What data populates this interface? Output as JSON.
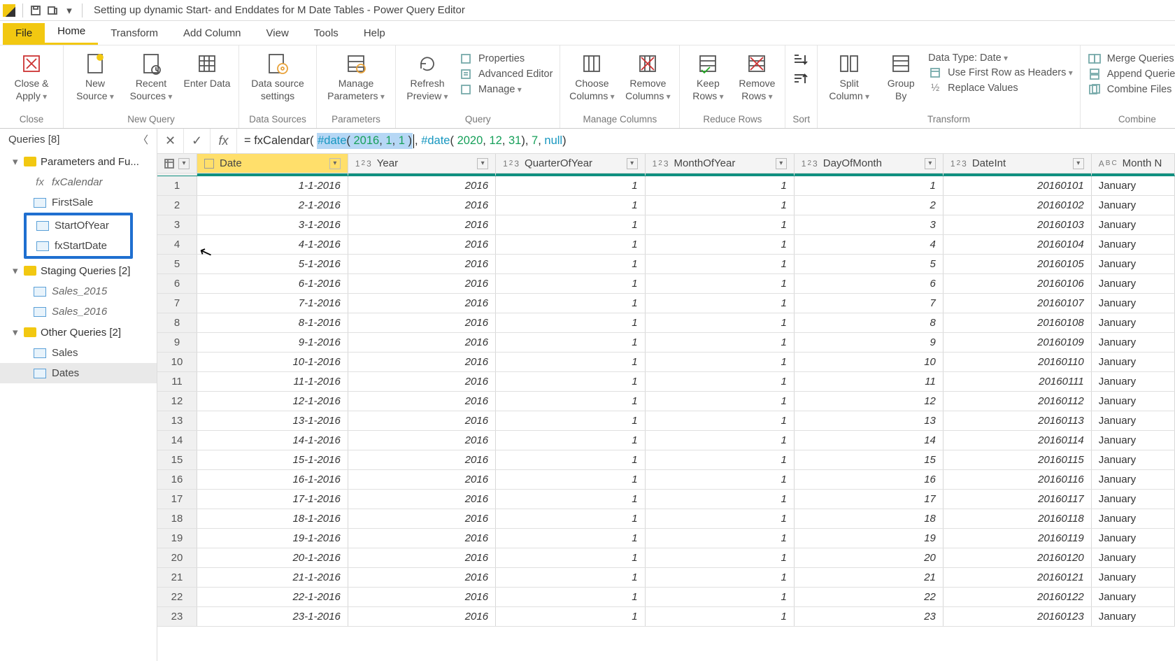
{
  "window": {
    "title": "Setting up dynamic Start- and Enddates for M Date Tables - Power Query Editor"
  },
  "tabs": {
    "file": "File",
    "home": "Home",
    "transform": "Transform",
    "addcolumn": "Add Column",
    "view": "View",
    "tools": "Tools",
    "help": "Help"
  },
  "ribbon": {
    "close_grp": "Close",
    "close_apply": "Close &\nApply",
    "newquery_grp": "New Query",
    "new_source": "New\nSource",
    "recent_sources": "Recent\nSources",
    "enter_data": "Enter\nData",
    "datasources_grp": "Data Sources",
    "data_source_settings": "Data source\nsettings",
    "parameters_grp": "Parameters",
    "manage_parameters": "Manage\nParameters",
    "query_grp": "Query",
    "refresh_preview": "Refresh\nPreview",
    "properties": "Properties",
    "advanced_editor": "Advanced Editor",
    "manage": "Manage",
    "managecols_grp": "Manage Columns",
    "choose_columns": "Choose\nColumns",
    "remove_columns": "Remove\nColumns",
    "reducerows_grp": "Reduce Rows",
    "keep_rows": "Keep\nRows",
    "remove_rows": "Remove\nRows",
    "sort_grp": "Sort",
    "transform_grp": "Transform",
    "split_column": "Split\nColumn",
    "group_by": "Group\nBy",
    "data_type": "Data Type: Date",
    "first_row_headers": "Use First Row as Headers",
    "replace_values": "Replace Values",
    "combine_grp": "Combine",
    "merge_queries": "Merge Queries",
    "append_queries": "Append Queries",
    "combine_files": "Combine Files"
  },
  "side": {
    "header": "Queries [8]",
    "group_params": "Parameters and Fu...",
    "fxCalendar": "fxCalendar",
    "firstSale": "FirstSale",
    "startOfYear": "StartOfYear",
    "fxStartDate": "fxStartDate",
    "group_staging": "Staging Queries [2]",
    "sales_2015": "Sales_2015",
    "sales_2016": "Sales_2016",
    "group_other": "Other Queries [2]",
    "sales": "Sales",
    "dates": "Dates"
  },
  "formula": {
    "pre": "= fxCalendar( ",
    "sel_open": "#date",
    "sel_paren": "( ",
    "sel_n1": "2016",
    "sel_c1": ", ",
    "sel_n2": "1",
    "sel_c2": ", ",
    "sel_n3": "1",
    "sel_close": " )",
    "mid": ", ",
    "kw2": "#date",
    "p2": "( ",
    "n4": "2020",
    "c3": ", ",
    "n5": "12",
    "c4": ", ",
    "n6": "31",
    "p2c": "), ",
    "n7": "7",
    "c5": ", ",
    "null": "null",
    "end": ")"
  },
  "columns": {
    "date": "Date",
    "year": "Year",
    "quarter": "QuarterOfYear",
    "month": "MonthOfYear",
    "day": "DayOfMonth",
    "dateint": "DateInt",
    "monthname": "Month N"
  },
  "rows": [
    {
      "n": 1,
      "date": "1-1-2016",
      "year": 2016,
      "q": 1,
      "m": 1,
      "d": 1,
      "di": 20160101,
      "mn": "January"
    },
    {
      "n": 2,
      "date": "2-1-2016",
      "year": 2016,
      "q": 1,
      "m": 1,
      "d": 2,
      "di": 20160102,
      "mn": "January"
    },
    {
      "n": 3,
      "date": "3-1-2016",
      "year": 2016,
      "q": 1,
      "m": 1,
      "d": 3,
      "di": 20160103,
      "mn": "January"
    },
    {
      "n": 4,
      "date": "4-1-2016",
      "year": 2016,
      "q": 1,
      "m": 1,
      "d": 4,
      "di": 20160104,
      "mn": "January"
    },
    {
      "n": 5,
      "date": "5-1-2016",
      "year": 2016,
      "q": 1,
      "m": 1,
      "d": 5,
      "di": 20160105,
      "mn": "January"
    },
    {
      "n": 6,
      "date": "6-1-2016",
      "year": 2016,
      "q": 1,
      "m": 1,
      "d": 6,
      "di": 20160106,
      "mn": "January"
    },
    {
      "n": 7,
      "date": "7-1-2016",
      "year": 2016,
      "q": 1,
      "m": 1,
      "d": 7,
      "di": 20160107,
      "mn": "January"
    },
    {
      "n": 8,
      "date": "8-1-2016",
      "year": 2016,
      "q": 1,
      "m": 1,
      "d": 8,
      "di": 20160108,
      "mn": "January"
    },
    {
      "n": 9,
      "date": "9-1-2016",
      "year": 2016,
      "q": 1,
      "m": 1,
      "d": 9,
      "di": 20160109,
      "mn": "January"
    },
    {
      "n": 10,
      "date": "10-1-2016",
      "year": 2016,
      "q": 1,
      "m": 1,
      "d": 10,
      "di": 20160110,
      "mn": "January"
    },
    {
      "n": 11,
      "date": "11-1-2016",
      "year": 2016,
      "q": 1,
      "m": 1,
      "d": 11,
      "di": 20160111,
      "mn": "January"
    },
    {
      "n": 12,
      "date": "12-1-2016",
      "year": 2016,
      "q": 1,
      "m": 1,
      "d": 12,
      "di": 20160112,
      "mn": "January"
    },
    {
      "n": 13,
      "date": "13-1-2016",
      "year": 2016,
      "q": 1,
      "m": 1,
      "d": 13,
      "di": 20160113,
      "mn": "January"
    },
    {
      "n": 14,
      "date": "14-1-2016",
      "year": 2016,
      "q": 1,
      "m": 1,
      "d": 14,
      "di": 20160114,
      "mn": "January"
    },
    {
      "n": 15,
      "date": "15-1-2016",
      "year": 2016,
      "q": 1,
      "m": 1,
      "d": 15,
      "di": 20160115,
      "mn": "January"
    },
    {
      "n": 16,
      "date": "16-1-2016",
      "year": 2016,
      "q": 1,
      "m": 1,
      "d": 16,
      "di": 20160116,
      "mn": "January"
    },
    {
      "n": 17,
      "date": "17-1-2016",
      "year": 2016,
      "q": 1,
      "m": 1,
      "d": 17,
      "di": 20160117,
      "mn": "January"
    },
    {
      "n": 18,
      "date": "18-1-2016",
      "year": 2016,
      "q": 1,
      "m": 1,
      "d": 18,
      "di": 20160118,
      "mn": "January"
    },
    {
      "n": 19,
      "date": "19-1-2016",
      "year": 2016,
      "q": 1,
      "m": 1,
      "d": 19,
      "di": 20160119,
      "mn": "January"
    },
    {
      "n": 20,
      "date": "20-1-2016",
      "year": 2016,
      "q": 1,
      "m": 1,
      "d": 20,
      "di": 20160120,
      "mn": "January"
    },
    {
      "n": 21,
      "date": "21-1-2016",
      "year": 2016,
      "q": 1,
      "m": 1,
      "d": 21,
      "di": 20160121,
      "mn": "January"
    },
    {
      "n": 22,
      "date": "22-1-2016",
      "year": 2016,
      "q": 1,
      "m": 1,
      "d": 22,
      "di": 20160122,
      "mn": "January"
    },
    {
      "n": 23,
      "date": "23-1-2016",
      "year": 2016,
      "q": 1,
      "m": 1,
      "d": 23,
      "di": 20160123,
      "mn": "January"
    }
  ]
}
